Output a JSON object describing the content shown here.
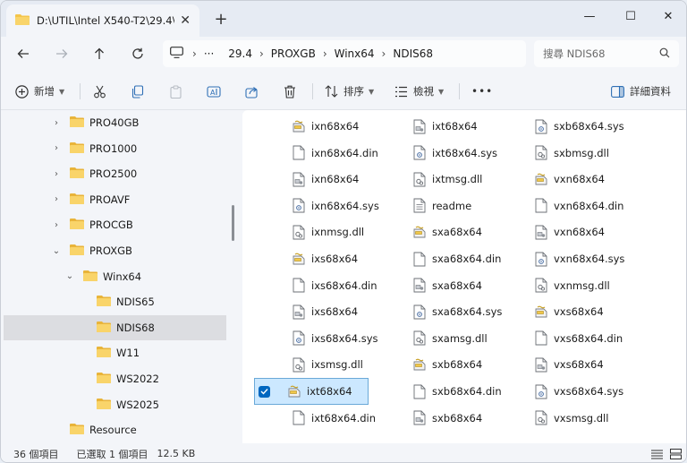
{
  "tab": {
    "title": "D:\\UTIL\\Intel X540-T2\\29.4\\PF",
    "close_glyph": "✕"
  },
  "new_tab_glyph": "+",
  "window_controls": {
    "minimize": "—",
    "maximize": "☐",
    "close": "✕"
  },
  "breadcrumb": [
    "29.4",
    "PROXGB",
    "Winx64",
    "NDIS68"
  ],
  "breadcrumb_overflow": "···",
  "search": {
    "placeholder": "搜尋 NDIS68"
  },
  "toolbar": {
    "new_label": "新增",
    "sort_label": "排序",
    "view_label": "檢視",
    "more_label": "•••",
    "details_label": "詳細資料"
  },
  "tree": [
    {
      "label": "PRO40GB",
      "expander": "›",
      "selected": false,
      "indent": 0
    },
    {
      "label": "PRO1000",
      "expander": "›",
      "selected": false,
      "indent": 0
    },
    {
      "label": "PRO2500",
      "expander": "›",
      "selected": false,
      "indent": 0
    },
    {
      "label": "PROAVF",
      "expander": "›",
      "selected": false,
      "indent": 0
    },
    {
      "label": "PROCGB",
      "expander": "›",
      "selected": false,
      "indent": 0
    },
    {
      "label": "PROXGB",
      "expander": "⌄",
      "selected": false,
      "indent": 0
    },
    {
      "label": "Winx64",
      "expander": "⌄",
      "selected": false,
      "indent": 1
    },
    {
      "label": "NDIS65",
      "expander": "",
      "selected": false,
      "indent": 2
    },
    {
      "label": "NDIS68",
      "expander": "",
      "selected": true,
      "indent": 2
    },
    {
      "label": "W11",
      "expander": "",
      "selected": false,
      "indent": 2
    },
    {
      "label": "WS2022",
      "expander": "",
      "selected": false,
      "indent": 2
    },
    {
      "label": "WS2025",
      "expander": "",
      "selected": false,
      "indent": 2
    },
    {
      "label": "Resource",
      "expander": "",
      "selected": false,
      "indent": 0
    }
  ],
  "files": [
    [
      {
        "name": "ixn68x64",
        "icon": "cat-icon"
      },
      {
        "name": "ixn68x64.din",
        "icon": "blank-file-icon"
      },
      {
        "name": "ixn68x64",
        "icon": "inf-icon"
      },
      {
        "name": "ixn68x64.sys",
        "icon": "sys-file-icon"
      },
      {
        "name": "ixnmsg.dll",
        "icon": "dll-file-icon"
      },
      {
        "name": "ixs68x64",
        "icon": "cat-icon"
      },
      {
        "name": "ixs68x64.din",
        "icon": "blank-file-icon"
      },
      {
        "name": "ixs68x64",
        "icon": "inf-icon"
      },
      {
        "name": "ixs68x64.sys",
        "icon": "sys-file-icon"
      },
      {
        "name": "ixsmsg.dll",
        "icon": "dll-file-icon"
      },
      {
        "name": "ixt68x64",
        "icon": "cat-icon",
        "selected": true
      },
      {
        "name": "ixt68x64.din",
        "icon": "blank-file-icon"
      }
    ],
    [
      {
        "name": "ixt68x64",
        "icon": "inf-icon"
      },
      {
        "name": "ixt68x64.sys",
        "icon": "sys-file-icon"
      },
      {
        "name": "ixtmsg.dll",
        "icon": "dll-file-icon"
      },
      {
        "name": "readme",
        "icon": "text-file-icon"
      },
      {
        "name": "sxa68x64",
        "icon": "cat-icon"
      },
      {
        "name": "sxa68x64.din",
        "icon": "blank-file-icon"
      },
      {
        "name": "sxa68x64",
        "icon": "inf-icon"
      },
      {
        "name": "sxa68x64.sys",
        "icon": "sys-file-icon"
      },
      {
        "name": "sxamsg.dll",
        "icon": "dll-file-icon"
      },
      {
        "name": "sxb68x64",
        "icon": "cat-icon"
      },
      {
        "name": "sxb68x64.din",
        "icon": "blank-file-icon"
      },
      {
        "name": "sxb68x64",
        "icon": "inf-icon"
      }
    ],
    [
      {
        "name": "sxb68x64.sys",
        "icon": "sys-file-icon"
      },
      {
        "name": "sxbmsg.dll",
        "icon": "dll-file-icon"
      },
      {
        "name": "vxn68x64",
        "icon": "cat-icon"
      },
      {
        "name": "vxn68x64.din",
        "icon": "blank-file-icon"
      },
      {
        "name": "vxn68x64",
        "icon": "inf-icon"
      },
      {
        "name": "vxn68x64.sys",
        "icon": "sys-file-icon"
      },
      {
        "name": "vxnmsg.dll",
        "icon": "dll-file-icon"
      },
      {
        "name": "vxs68x64",
        "icon": "cat-icon"
      },
      {
        "name": "vxs68x64.din",
        "icon": "blank-file-icon"
      },
      {
        "name": "vxs68x64",
        "icon": "inf-icon"
      },
      {
        "name": "vxs68x64.sys",
        "icon": "sys-file-icon"
      },
      {
        "name": "vxsmsg.dll",
        "icon": "dll-file-icon"
      }
    ]
  ],
  "status": {
    "item_count": "36 個項目",
    "selected": "已選取 1 個項目",
    "size": "12.5 KB"
  },
  "colors": {
    "accent": "#0067c0",
    "folder": "#f4c54a",
    "selection": "#cce8ff"
  }
}
